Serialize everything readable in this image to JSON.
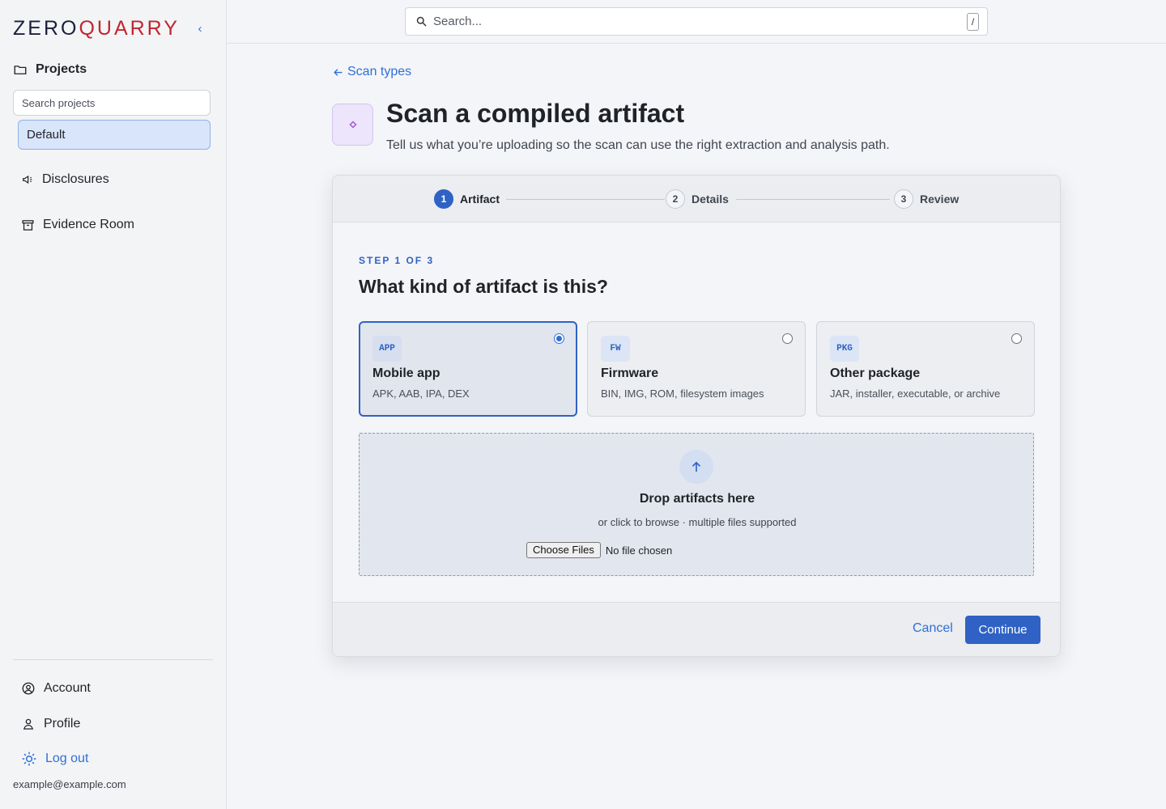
{
  "brand": {
    "zero": "ZERO",
    "quarry": "QUARRY"
  },
  "sidebar": {
    "collapse_glyph": "‹",
    "projects_title": "Projects",
    "project_search_placeholder": "Search projects",
    "projects": [
      {
        "label": "Default",
        "selected": true
      }
    ],
    "nav": [
      {
        "label": "Disclosures",
        "icon": "megaphone-icon"
      },
      {
        "label": "Evidence Room",
        "icon": "archive-icon"
      }
    ],
    "bottom": [
      {
        "label": "Account",
        "icon": "user-circle-icon"
      },
      {
        "label": "Profile",
        "icon": "user-icon"
      }
    ],
    "logout_label": "Log out",
    "user_email": "example@example.com"
  },
  "topbar": {
    "search_placeholder": "Search...",
    "shortcut_key": "/"
  },
  "main": {
    "back_label": "Scan types",
    "title": "Scan a compiled artifact",
    "subtitle": "Tell us what you’re uploading so the scan can use the right extraction and analysis path.",
    "steps": [
      {
        "num": "1",
        "label": "Artifact",
        "active": true
      },
      {
        "num": "2",
        "label": "Details",
        "active": false
      },
      {
        "num": "3",
        "label": "Review",
        "active": false
      }
    ],
    "eyebrow": "STEP 1 OF 3",
    "question": "What kind of artifact is this?",
    "options": [
      {
        "badge": "APP",
        "name": "Mobile app",
        "desc": "APK, AAB, IPA, DEX",
        "selected": true
      },
      {
        "badge": "FW",
        "name": "Firmware",
        "desc": "BIN, IMG, ROM, filesystem images",
        "selected": false
      },
      {
        "badge": "PKG",
        "name": "Other package",
        "desc": "JAR, installer, executable, or archive",
        "selected": false
      }
    ],
    "dropzone": {
      "title": "Drop artifacts here",
      "subtitle": "or click to browse · multiple files supported",
      "choose_label": "Choose Files",
      "no_file_label": "No file chosen"
    },
    "footer": {
      "cancel_label": "Cancel",
      "continue_label": "Continue"
    }
  },
  "colors": {
    "accent": "#2f62c4",
    "link": "#2f6fd6",
    "brand_red": "#c0262d",
    "brand_dark": "#1b1f3b"
  }
}
